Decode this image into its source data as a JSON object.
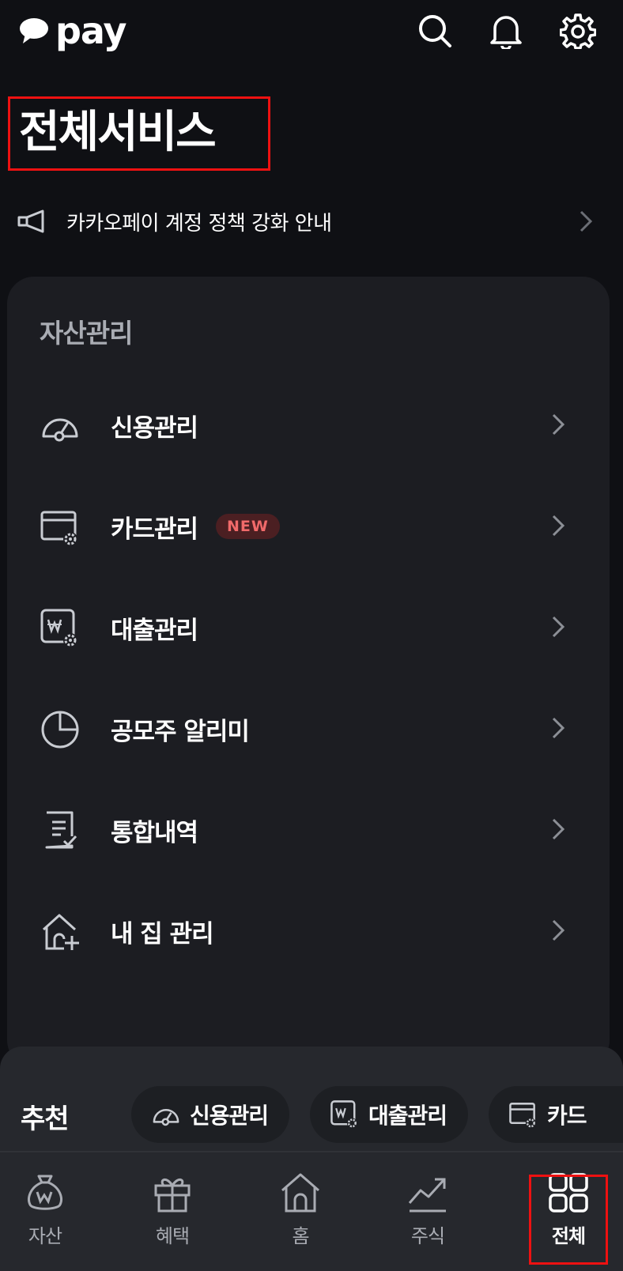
{
  "app": {
    "logo_text": "pay"
  },
  "header": {
    "icons": [
      "search-icon",
      "bell-icon",
      "gear-icon"
    ]
  },
  "page": {
    "title": "전체서비스"
  },
  "notice": {
    "text": "카카오페이 계정 정책 강화 안내"
  },
  "asset_section": {
    "title": "자산관리",
    "items": [
      {
        "label": "신용관리",
        "icon": "gauge-icon"
      },
      {
        "label": "카드관리",
        "icon": "card-settings-icon",
        "badge": "NEW"
      },
      {
        "label": "대출관리",
        "icon": "loan-settings-icon"
      },
      {
        "label": "공모주 알리미",
        "icon": "pie-chart-icon"
      },
      {
        "label": "통합내역",
        "icon": "document-check-icon"
      },
      {
        "label": "내 집 관리",
        "icon": "house-plus-icon"
      }
    ]
  },
  "recommend": {
    "label": "추천",
    "chips": [
      {
        "label": "신용관리",
        "icon": "gauge-icon"
      },
      {
        "label": "대출관리",
        "icon": "loan-settings-icon"
      },
      {
        "label": "카드",
        "icon": "card-settings-icon"
      }
    ]
  },
  "bottom_nav": {
    "items": [
      {
        "label": "자산",
        "icon": "money-bag-icon"
      },
      {
        "label": "혜택",
        "icon": "gift-icon"
      },
      {
        "label": "홈",
        "icon": "home-icon"
      },
      {
        "label": "주식",
        "icon": "trend-chart-icon"
      },
      {
        "label": "전체",
        "icon": "grid-icon",
        "active": true
      }
    ]
  },
  "colors": {
    "background": "#0f1014",
    "panel": "#1c1d22",
    "sheet": "#26282d",
    "badge_text": "#f06a6a",
    "highlight": "#e11111"
  }
}
